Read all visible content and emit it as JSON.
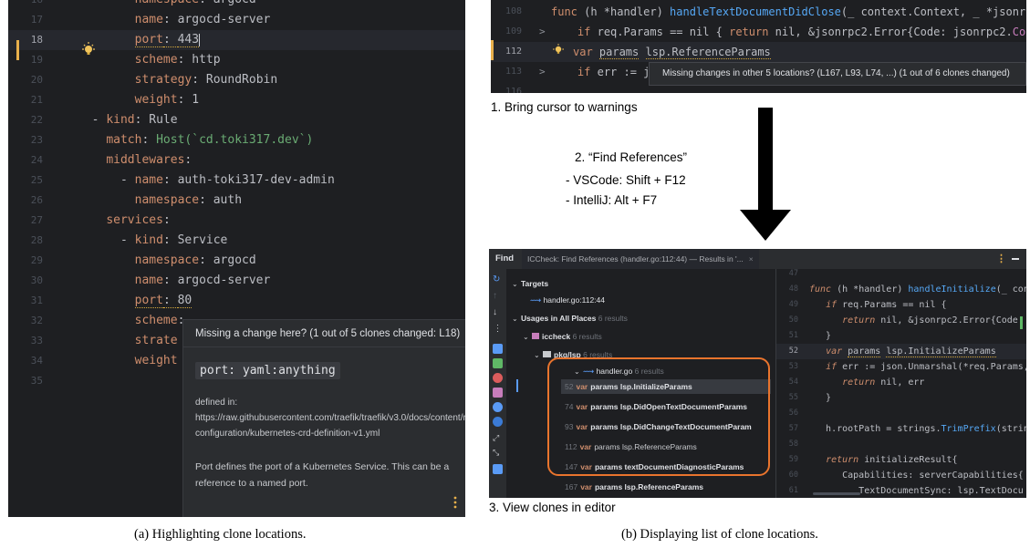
{
  "panel_a": {
    "lines": [
      {
        "num": "16",
        "indent": "        ",
        "key": "namespace",
        "val": "argocd",
        "partial": true
      },
      {
        "num": "17",
        "indent": "        ",
        "key": "name",
        "val": "argocd-server"
      },
      {
        "num": "18",
        "indent": "        ",
        "key": "port",
        "val": "443",
        "current": true,
        "warning": true
      },
      {
        "num": "19",
        "indent": "        ",
        "key": "scheme",
        "val": "http"
      },
      {
        "num": "20",
        "indent": "        ",
        "key": "strategy",
        "val": "RoundRobin"
      },
      {
        "num": "21",
        "indent": "        ",
        "key": "weight",
        "val": "1"
      },
      {
        "num": "22",
        "indent": "  - ",
        "key": "kind",
        "val": "Rule"
      },
      {
        "num": "23",
        "indent": "    ",
        "key": "match",
        "val": "Host(`cd.toki317.dev`)",
        "string": true
      },
      {
        "num": "24",
        "indent": "    ",
        "key": "middlewares",
        "val": ""
      },
      {
        "num": "25",
        "indent": "      - ",
        "key": "name",
        "val": "auth-toki317-dev-admin"
      },
      {
        "num": "26",
        "indent": "        ",
        "key": "namespace",
        "val": "auth"
      },
      {
        "num": "27",
        "indent": "    ",
        "key": "services",
        "val": ""
      },
      {
        "num": "28",
        "indent": "      - ",
        "key": "kind",
        "val": "Service"
      },
      {
        "num": "29",
        "indent": "        ",
        "key": "namespace",
        "val": "argocd"
      },
      {
        "num": "30",
        "indent": "        ",
        "key": "name",
        "val": "argocd-server"
      },
      {
        "num": "31",
        "indent": "        ",
        "key": "port",
        "val": "80",
        "warning": true
      },
      {
        "num": "32",
        "indent": "        ",
        "key": "scheme",
        "val": "",
        "truncated": true
      },
      {
        "num": "33",
        "indent": "        ",
        "key": "strate",
        "val": "",
        "truncated": true,
        "no_colon": true
      },
      {
        "num": "34",
        "indent": "        ",
        "key": "weight",
        "val": "",
        "truncated": true,
        "no_colon": true
      },
      {
        "num": "35",
        "indent": "",
        "key": "",
        "val": ""
      }
    ],
    "popup": {
      "header": "Missing a change here? (1 out of 5 clones changed: L18)",
      "signature": "port: yaml:anything",
      "source": "defined in: https://raw.githubusercontent.com/traefik/traefik/v3.0/docs/content/reference/dynamic-configuration/kubernetes-crd-definition-v1.yml",
      "description": "Port defines the port of a Kubernetes Service. This can be a reference to a named port."
    },
    "caption": "(a) Highlighting clone locations."
  },
  "panel_b_top": {
    "lines": [
      {
        "num": "108",
        "code_parts": [
          [
            "k",
            "func "
          ],
          [
            "v",
            "(h *handler) "
          ],
          [
            "fn",
            "handleTextDocumentDidClose"
          ],
          [
            "v",
            "(_ context.Context, _ *jsonrpc"
          ]
        ]
      },
      {
        "num": "109",
        "arrow": ">",
        "code_parts": [
          [
            "v",
            "    "
          ],
          [
            "k",
            "if "
          ],
          [
            "v",
            "req.Params == nil { "
          ],
          [
            "k",
            "return "
          ],
          [
            "v",
            "nil, &jsonrpc2.Error{Code: jsonrpc2."
          ],
          [
            "gold",
            "Code"
          ]
        ]
      },
      {
        "num": "112",
        "current": true,
        "code_parts": [
          [
            "k",
            "var "
          ],
          [
            "u",
            "params"
          ],
          [
            "v",
            " "
          ],
          [
            "u",
            "lsp.ReferenceParams"
          ]
        ]
      },
      {
        "num": "113",
        "arrow": ">",
        "code_parts": [
          [
            "v",
            "    "
          ],
          [
            "k",
            "if "
          ],
          [
            "v",
            "err := j"
          ]
        ]
      },
      {
        "num": "116",
        "code_parts": []
      }
    ],
    "tooltip": "Missing changes in other 5 locations? (L167, L93, L74, ...) (1 out of 6 clones changed)"
  },
  "steps": {
    "step1": "1. Bring cursor to warnings",
    "step2_title": "2. “Find References”",
    "step2_items": [
      "-    VSCode: Shift + F12",
      "-    IntelliJ: Alt + F7"
    ],
    "step3": "3. View clones in editor"
  },
  "panel_b_find": {
    "title": "Find",
    "tab": "ICCheck: Find References (handler.go:112:44) — Results in '...",
    "tab_close": "×",
    "tree": {
      "targets_label": "Targets",
      "target_item": "handler.go:112:44",
      "usages_label": "Usages in All Places",
      "usages_count": "6 results",
      "pkg_label": "iccheck",
      "pkg_count": "6 results",
      "dir_label": "pkg/lsp",
      "dir_count": "6 results",
      "file_label": "handler.go",
      "file_count": "6 results",
      "results": [
        {
          "line": "52",
          "kw": "var",
          "text": "params lsp.InitializeParams",
          "selected": true
        },
        {
          "line": "74",
          "kw": "var",
          "text": "params lsp.DidOpenTextDocumentParams"
        },
        {
          "line": "93",
          "kw": "var",
          "text": "params lsp.DidChangeTextDocumentParam"
        },
        {
          "line": "112",
          "kw": "var",
          "text": "params lsp.ReferenceParams",
          "muted": true
        },
        {
          "line": "147",
          "kw": "var",
          "text": "params textDocumentDiagnosticParams"
        },
        {
          "line": "167",
          "kw": "var",
          "text": "params lsp.ReferenceParams"
        }
      ]
    },
    "editor": {
      "lines": [
        {
          "num": "47",
          "code_parts": []
        },
        {
          "num": "48",
          "code_parts": [
            [
              "it",
              "func "
            ],
            [
              "v",
              "(h *handler) "
            ],
            [
              "fn",
              "handleInitialize"
            ],
            [
              "v",
              "(_ conte"
            ]
          ]
        },
        {
          "num": "49",
          "code_parts": [
            [
              "v",
              "   "
            ],
            [
              "it",
              "if "
            ],
            [
              "v",
              "req.Params == nil {"
            ]
          ]
        },
        {
          "num": "50",
          "code_parts": [
            [
              "v",
              "      "
            ],
            [
              "it",
              "return "
            ],
            [
              "v",
              "nil, &jsonrpc2.Error{Code:"
            ]
          ]
        },
        {
          "num": "51",
          "code_parts": [
            [
              "v",
              "   }"
            ]
          ]
        },
        {
          "num": "52",
          "current": true,
          "code_parts": [
            [
              "v",
              "   "
            ],
            [
              "it",
              "var "
            ],
            [
              "u",
              "params"
            ],
            [
              "v",
              " "
            ],
            [
              "u",
              "lsp.InitializeParams"
            ]
          ]
        },
        {
          "num": "53",
          "code_parts": [
            [
              "v",
              "   "
            ],
            [
              "it",
              "if "
            ],
            [
              "v",
              "err := json.Unmarshal(*req.Params, &"
            ]
          ]
        },
        {
          "num": "54",
          "code_parts": [
            [
              "v",
              "      "
            ],
            [
              "it",
              "return "
            ],
            [
              "v",
              "nil, err"
            ]
          ]
        },
        {
          "num": "55",
          "code_parts": [
            [
              "v",
              "   }"
            ]
          ]
        },
        {
          "num": "56",
          "code_parts": []
        },
        {
          "num": "57",
          "code_parts": [
            [
              "v",
              "   h.rootPath = strings."
            ],
            [
              "fn",
              "TrimPrefix"
            ],
            [
              "v",
              "(string"
            ]
          ]
        },
        {
          "num": "58",
          "code_parts": []
        },
        {
          "num": "59",
          "code_parts": [
            [
              "v",
              "   "
            ],
            [
              "it",
              "return "
            ],
            [
              "v",
              "initializeResult{"
            ]
          ]
        },
        {
          "num": "60",
          "code_parts": [
            [
              "v",
              "      Capabilities: serverCapabilities{"
            ]
          ]
        },
        {
          "num": "61",
          "code_parts": [
            [
              "v",
              "         TextDocumentSync: lsp.TextDocu"
            ]
          ]
        }
      ]
    }
  },
  "caption_b": "(b) Displaying list of clone locations.",
  "colors": {
    "editor_bg": "#1e1f22",
    "keyword": "#cf8e6d",
    "function": "#56a8f5",
    "warning": "#e8b04b",
    "highlight_box": "#e9742d"
  }
}
